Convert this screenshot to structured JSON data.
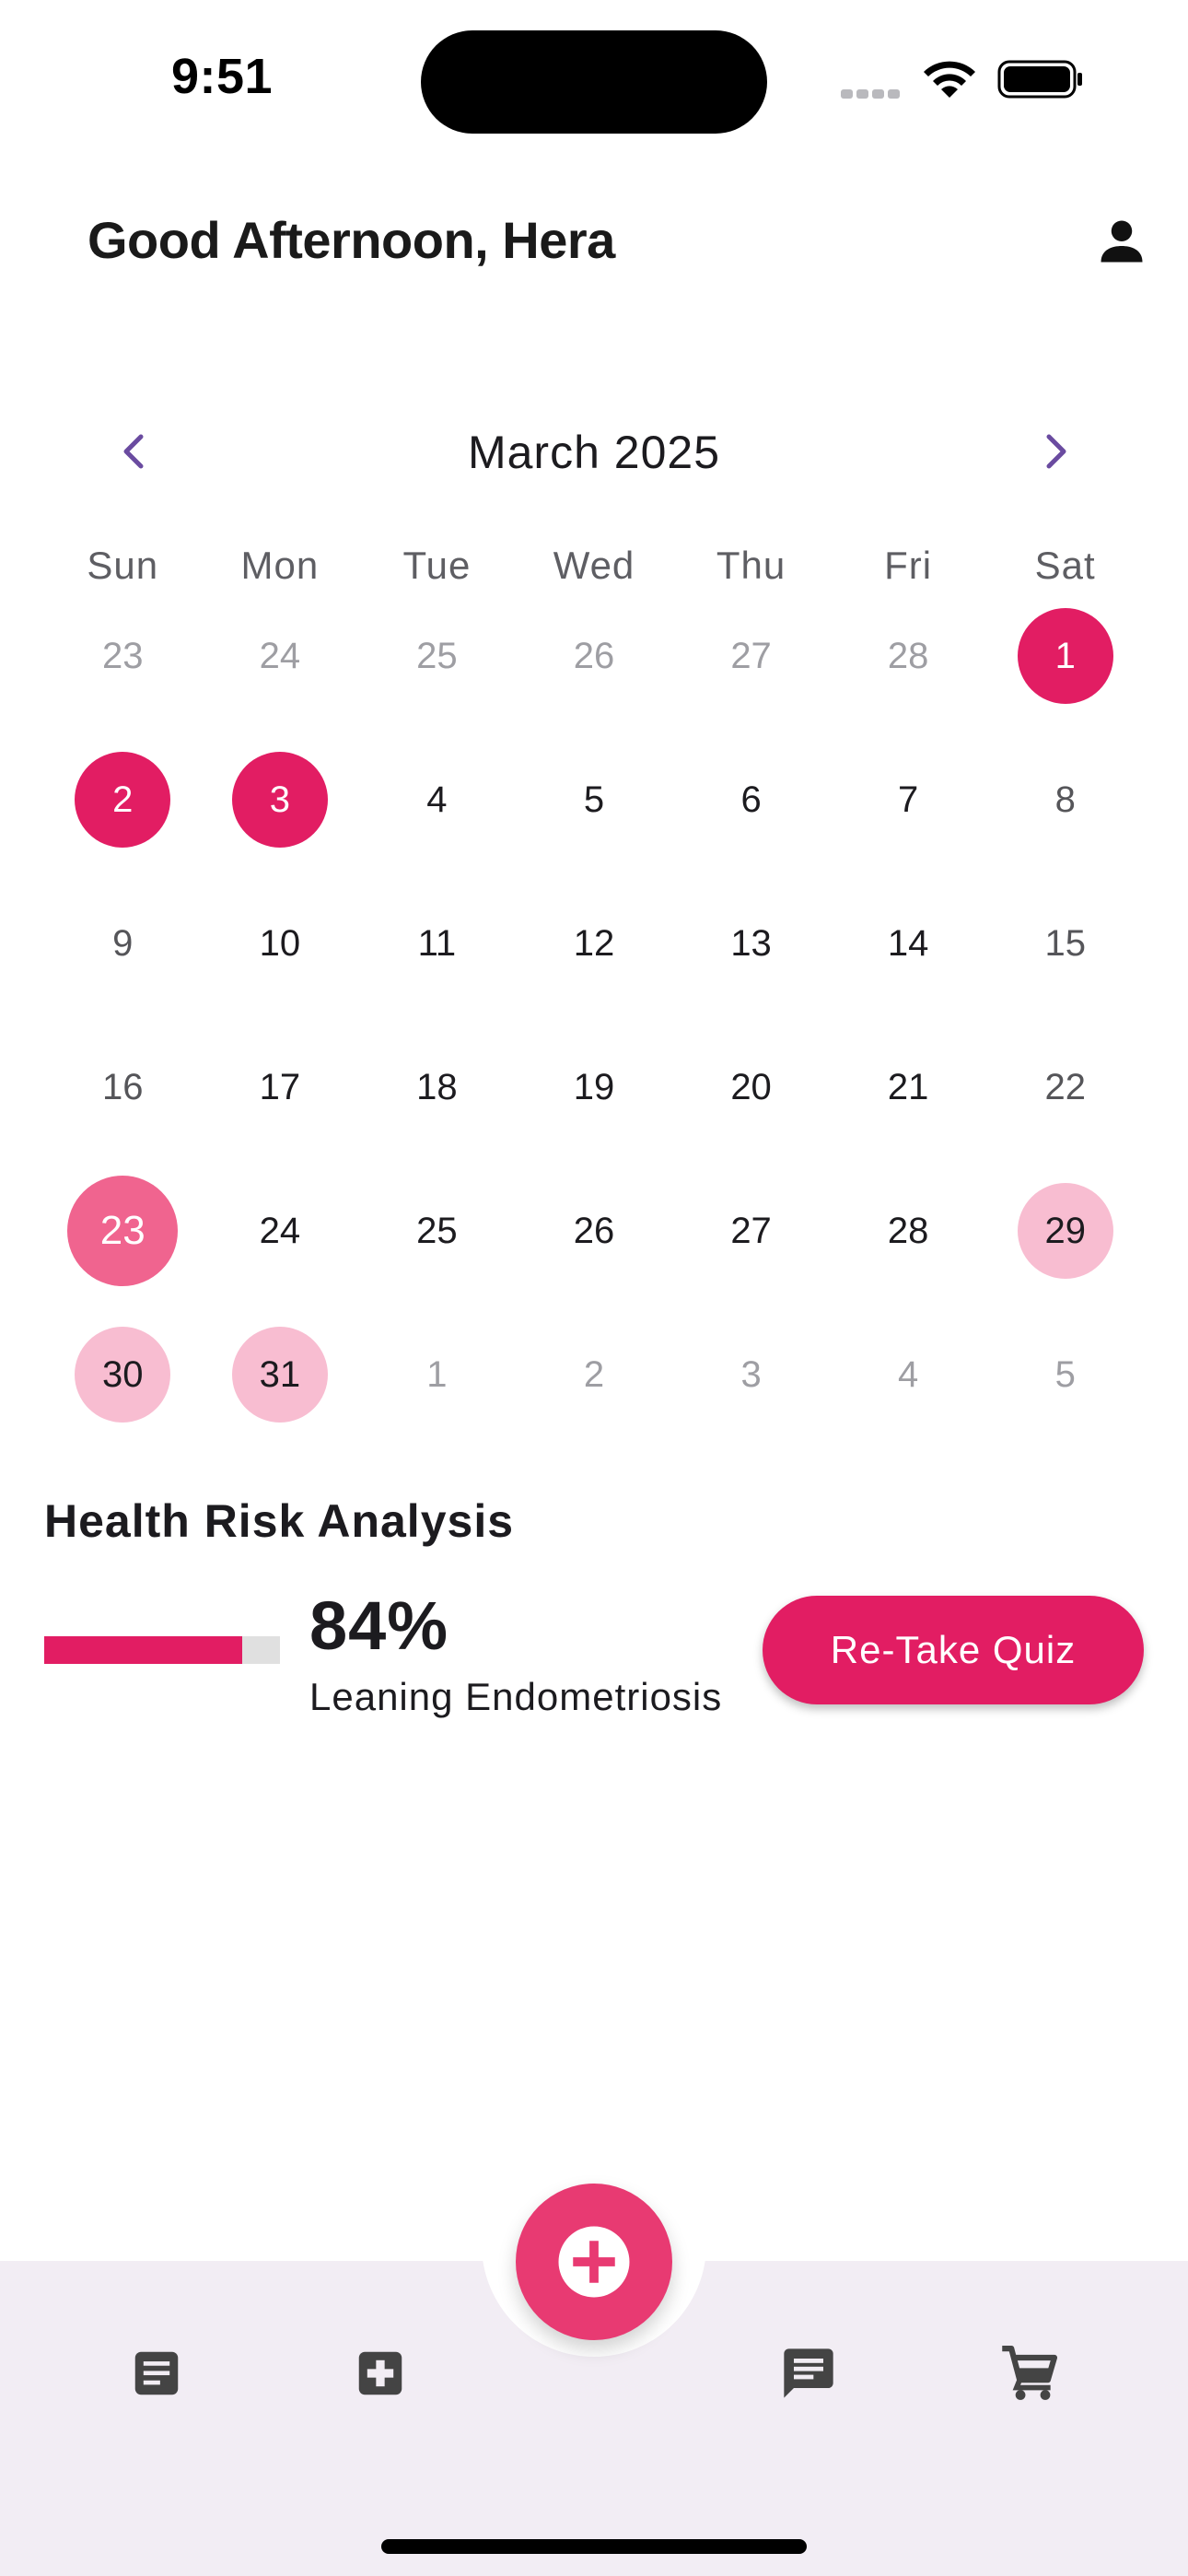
{
  "status_bar": {
    "time": "9:51"
  },
  "header": {
    "greeting": "Good Afternoon, Hera",
    "profile_icon": "person-icon"
  },
  "calendar": {
    "month_title": "March 2025",
    "prev_icon": "chevron-left-icon",
    "next_icon": "chevron-right-icon",
    "weekdays": [
      "Sun",
      "Mon",
      "Tue",
      "Wed",
      "Thu",
      "Fri",
      "Sat"
    ],
    "days": [
      {
        "label": "23",
        "state": "outside"
      },
      {
        "label": "24",
        "state": "outside"
      },
      {
        "label": "25",
        "state": "outside"
      },
      {
        "label": "26",
        "state": "outside"
      },
      {
        "label": "27",
        "state": "outside"
      },
      {
        "label": "28",
        "state": "outside"
      },
      {
        "label": "1",
        "state": "period"
      },
      {
        "label": "2",
        "state": "period"
      },
      {
        "label": "3",
        "state": "period"
      },
      {
        "label": "4",
        "state": "normal"
      },
      {
        "label": "5",
        "state": "normal"
      },
      {
        "label": "6",
        "state": "normal"
      },
      {
        "label": "7",
        "state": "normal"
      },
      {
        "label": "8",
        "state": "weekend"
      },
      {
        "label": "9",
        "state": "weekend"
      },
      {
        "label": "10",
        "state": "normal"
      },
      {
        "label": "11",
        "state": "normal"
      },
      {
        "label": "12",
        "state": "normal"
      },
      {
        "label": "13",
        "state": "normal"
      },
      {
        "label": "14",
        "state": "normal"
      },
      {
        "label": "15",
        "state": "weekend"
      },
      {
        "label": "16",
        "state": "weekend"
      },
      {
        "label": "17",
        "state": "normal"
      },
      {
        "label": "18",
        "state": "normal"
      },
      {
        "label": "19",
        "state": "normal"
      },
      {
        "label": "20",
        "state": "normal"
      },
      {
        "label": "21",
        "state": "normal"
      },
      {
        "label": "22",
        "state": "weekend"
      },
      {
        "label": "23",
        "state": "today"
      },
      {
        "label": "24",
        "state": "normal"
      },
      {
        "label": "25",
        "state": "normal"
      },
      {
        "label": "26",
        "state": "normal"
      },
      {
        "label": "27",
        "state": "normal"
      },
      {
        "label": "28",
        "state": "normal"
      },
      {
        "label": "29",
        "state": "predicted"
      },
      {
        "label": "30",
        "state": "predicted"
      },
      {
        "label": "31",
        "state": "predicted"
      },
      {
        "label": "1",
        "state": "outside"
      },
      {
        "label": "2",
        "state": "outside"
      },
      {
        "label": "3",
        "state": "outside"
      },
      {
        "label": "4",
        "state": "outside"
      },
      {
        "label": "5",
        "state": "outside"
      }
    ]
  },
  "health_risk": {
    "title": "Health Risk Analysis",
    "percent_text": "84%",
    "percent_value": 0.84,
    "label": "Leaning Endometriosis",
    "retake_label": "Re-Take Quiz"
  },
  "bottom_nav": {
    "items": [
      {
        "icon": "article-icon"
      },
      {
        "icon": "medical-plus-icon"
      },
      {
        "icon": "chat-icon"
      },
      {
        "icon": "cart-icon"
      }
    ],
    "fab_icon": "add-circle-icon"
  },
  "colors": {
    "accent": "#e21d63",
    "today": "#f0648f",
    "predicted": "#f8bdd1",
    "fab": "#e83a72",
    "nav_bg": "#f2edf4"
  }
}
